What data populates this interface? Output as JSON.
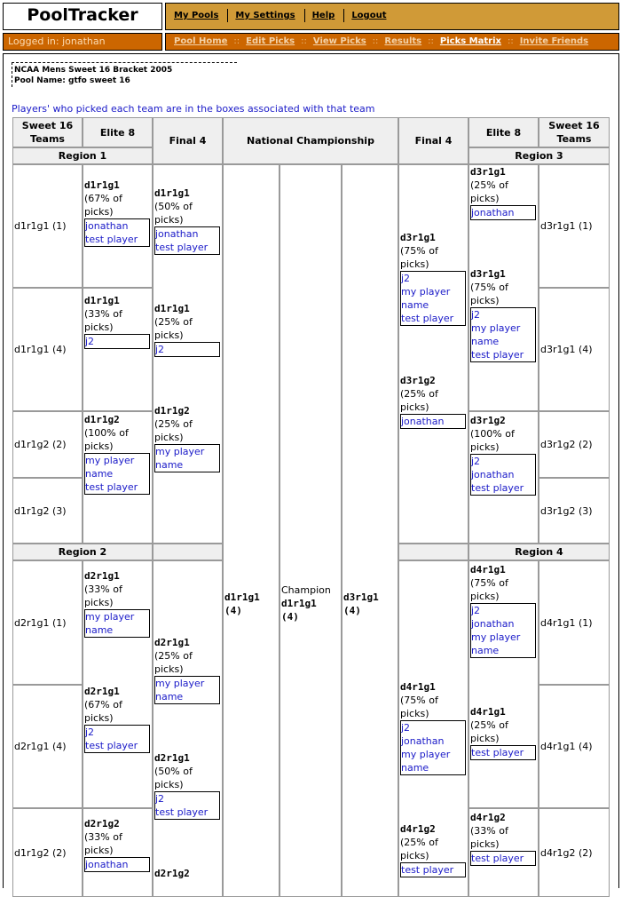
{
  "app": {
    "title": "PoolTracker",
    "logged_in": "Logged in: jonathan"
  },
  "topnav": [
    {
      "label": "My Pools"
    },
    {
      "label": "My Settings"
    },
    {
      "label": "Help"
    },
    {
      "label": "Logout"
    }
  ],
  "subnav": [
    {
      "label": "Pool Home"
    },
    {
      "label": "Edit Picks"
    },
    {
      "label": "View Picks"
    },
    {
      "label": "Results"
    },
    {
      "label": "Picks Matrix",
      "active": true
    },
    {
      "label": "Invite Friends"
    }
  ],
  "subnav_separator": "::",
  "pool": {
    "bracket": "NCAA Mens Sweet 16 Bracket 2005",
    "name": "Pool Name: gtfo sweet 16"
  },
  "instructions": "Players' who picked each team are in the boxes associated with that team",
  "headers": {
    "sweet16": "Sweet 16 Teams",
    "elite8": "Elite 8",
    "final4": "Final 4",
    "national": "National Championship"
  },
  "regions": {
    "r1": "Region 1",
    "r2": "Region 2",
    "r3": "Region 3",
    "r4": "Region 4"
  },
  "left": {
    "r1_teams": [
      "d1r1g1 (1)",
      "d1r1g1 (4)",
      "d1r1g2 (2)",
      "d1r1g2 (3)"
    ],
    "r1_elite8": [
      {
        "team": "d1r1g1",
        "pct": "(67% of picks)",
        "players": [
          "jonathan",
          "test player"
        ]
      },
      {
        "team": "d1r1g1",
        "pct": "(33% of picks)",
        "players": [
          "j2"
        ]
      },
      {
        "team": "d1r1g2",
        "pct": "(100% of picks)",
        "players": [
          "my player name",
          "test player"
        ]
      }
    ],
    "r1_final4": [
      {
        "team": "d1r1g1",
        "pct": "(50% of picks)",
        "players": [
          "jonathan",
          "test player"
        ]
      },
      {
        "team": "d1r1g1",
        "pct": "(25% of picks)",
        "players": [
          "j2"
        ]
      },
      {
        "team": "d1r1g2",
        "pct": "(25% of picks)",
        "players": [
          "my player name"
        ]
      }
    ],
    "r2_teams": [
      "d2r1g1 (1)",
      "d2r1g1 (4)",
      "d1r1g2 (2)"
    ],
    "r2_elite8": [
      {
        "team": "d2r1g1",
        "pct": "(33% of picks)",
        "players": [
          "my player name"
        ]
      },
      {
        "team": "d2r1g1",
        "pct": "(67% of picks)",
        "players": [
          "j2",
          "test player"
        ]
      },
      {
        "team": "d2r1g2",
        "pct": "(33% of picks)",
        "players": [
          "jonathan"
        ]
      }
    ],
    "r2_final4": [
      {
        "team": "d2r1g1",
        "pct": "(25% of picks)",
        "players": [
          "my player name"
        ]
      },
      {
        "team": "d2r1g1",
        "pct": "(50% of picks)",
        "players": [
          "j2",
          "test player"
        ]
      },
      {
        "team": "d2r1g2",
        "pct": "",
        "players": []
      }
    ]
  },
  "right": {
    "r3_teams": [
      "d3r1g1 (1)",
      "d3r1g1 (4)",
      "d3r1g2 (2)",
      "d3r1g2 (3)"
    ],
    "r3_elite8": [
      {
        "team": "d3r1g1",
        "pct": "(25% of picks)",
        "players": [
          "jonathan"
        ]
      },
      {
        "team": "d3r1g1",
        "pct": "(75% of picks)",
        "players": [
          "j2",
          "my player name",
          "test player"
        ]
      },
      {
        "team": "d3r1g2",
        "pct": "(100% of picks)",
        "players": [
          "j2",
          "jonathan",
          "test player"
        ]
      }
    ],
    "r3_final4": [
      {
        "team": "d3r1g1",
        "pct": "(75% of picks)",
        "players": [
          "j2",
          "my player name",
          "test player"
        ]
      },
      {
        "team": "d3r1g2",
        "pct": "(25% of picks)",
        "players": [
          "jonathan"
        ]
      }
    ],
    "r4_teams": [
      "d4r1g1 (1)",
      "d4r1g1 (4)",
      "d4r1g2 (2)"
    ],
    "r4_elite8": [
      {
        "team": "d4r1g1",
        "pct": "(75% of picks)",
        "players": [
          "j2",
          "jonathan",
          "my player name"
        ]
      },
      {
        "team": "d4r1g1",
        "pct": "(25% of picks)",
        "players": [
          "test player"
        ]
      },
      {
        "team": "d4r1g2",
        "pct": "(33% of picks)",
        "players": [
          "test player"
        ]
      }
    ],
    "r4_final4": [
      {
        "team": "d4r1g1",
        "pct": "(75% of picks)",
        "players": [
          "j2",
          "jonathan",
          "my player name"
        ]
      },
      {
        "team": "d4r1g2",
        "pct": "(25% of picks)",
        "players": [
          "test player"
        ]
      }
    ]
  },
  "championship": {
    "left_finalist": {
      "team": "d1r1g1",
      "count": "(4)"
    },
    "champion_label": "Champion",
    "champion": {
      "team": "d1r1g1",
      "count": "(4)"
    },
    "right_finalist": {
      "team": "d3r1g1",
      "count": "(4)"
    }
  }
}
